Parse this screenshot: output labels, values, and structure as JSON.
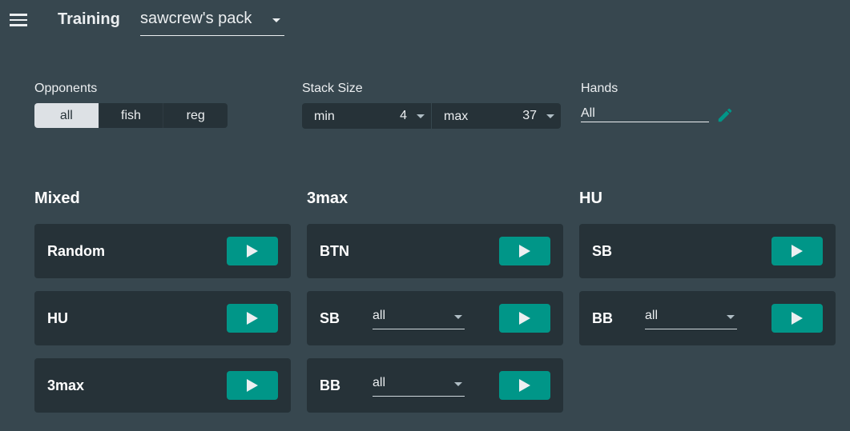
{
  "header": {
    "title": "Training",
    "pack": "sawcrew's pack"
  },
  "filters": {
    "opponents": {
      "label": "Opponents",
      "options": [
        "all",
        "fish",
        "reg"
      ],
      "selected": "all"
    },
    "stack_size": {
      "label": "Stack Size",
      "min_label": "min",
      "min_value": "4",
      "max_label": "max",
      "max_value": "37"
    },
    "hands": {
      "label": "Hands",
      "value": "All"
    }
  },
  "columns": [
    {
      "title": "Mixed",
      "cards": [
        {
          "name": "Random"
        },
        {
          "name": "HU"
        },
        {
          "name": "3max"
        }
      ]
    },
    {
      "title": "3max",
      "cards": [
        {
          "name": "BTN"
        },
        {
          "name": "SB",
          "select": "all"
        },
        {
          "name": "BB",
          "select": "all"
        }
      ]
    },
    {
      "title": "HU",
      "cards": [
        {
          "name": "SB"
        },
        {
          "name": "BB",
          "select": "all"
        }
      ]
    }
  ],
  "colors": {
    "background": "#37474f",
    "card": "#263238",
    "accent": "#009688"
  }
}
